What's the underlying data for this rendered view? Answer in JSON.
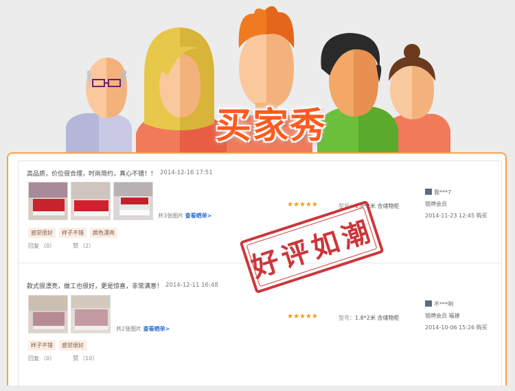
{
  "banner": {
    "title": "买家秀"
  },
  "stamp": {
    "text": "好评如潮"
  },
  "reviews": [
    {
      "text": "高品质，价位很合理，时尚简约，真心不错！！",
      "date": "2014-12-16 17:51",
      "photo_count": "共3张图片",
      "view_link": "查看晒单>",
      "tags": [
        "感觉很好",
        "样子不错",
        "颜色漂亮"
      ],
      "reply_label": "回复",
      "reply_count": "（0）",
      "like_label": "赞",
      "like_count": "（2）",
      "rating": 5,
      "model_label": "型号：",
      "model_value": "1.8*2米 含储物柜",
      "user_name": "我***7",
      "user_level": "银牌会员",
      "purchase_date": "2014-11-23 12:45 购买"
    },
    {
      "text": "款式很漂亮，做工也很好，更是惊喜，非常满意！",
      "date": "2014-12-11 16:48",
      "photo_count": "共2张图片",
      "view_link": "查看晒单>",
      "tags": [
        "样子不错",
        "感觉很好"
      ],
      "reply_label": "回复",
      "reply_count": "（0）",
      "like_label": "赞",
      "like_count": "（10）",
      "rating": 5,
      "model_label": "型号：",
      "model_value": "1.8*2米 含储物柜",
      "user_name": "不***咧",
      "user_level": "银牌会员  福建",
      "purchase_date": "2014-10-06 15:26 购买"
    }
  ],
  "colors": {
    "accent": "#f7a24b",
    "title": "#ff5a1f",
    "stamp": "#c8262a",
    "link": "#2c6fd1",
    "star": "#f39c12"
  }
}
